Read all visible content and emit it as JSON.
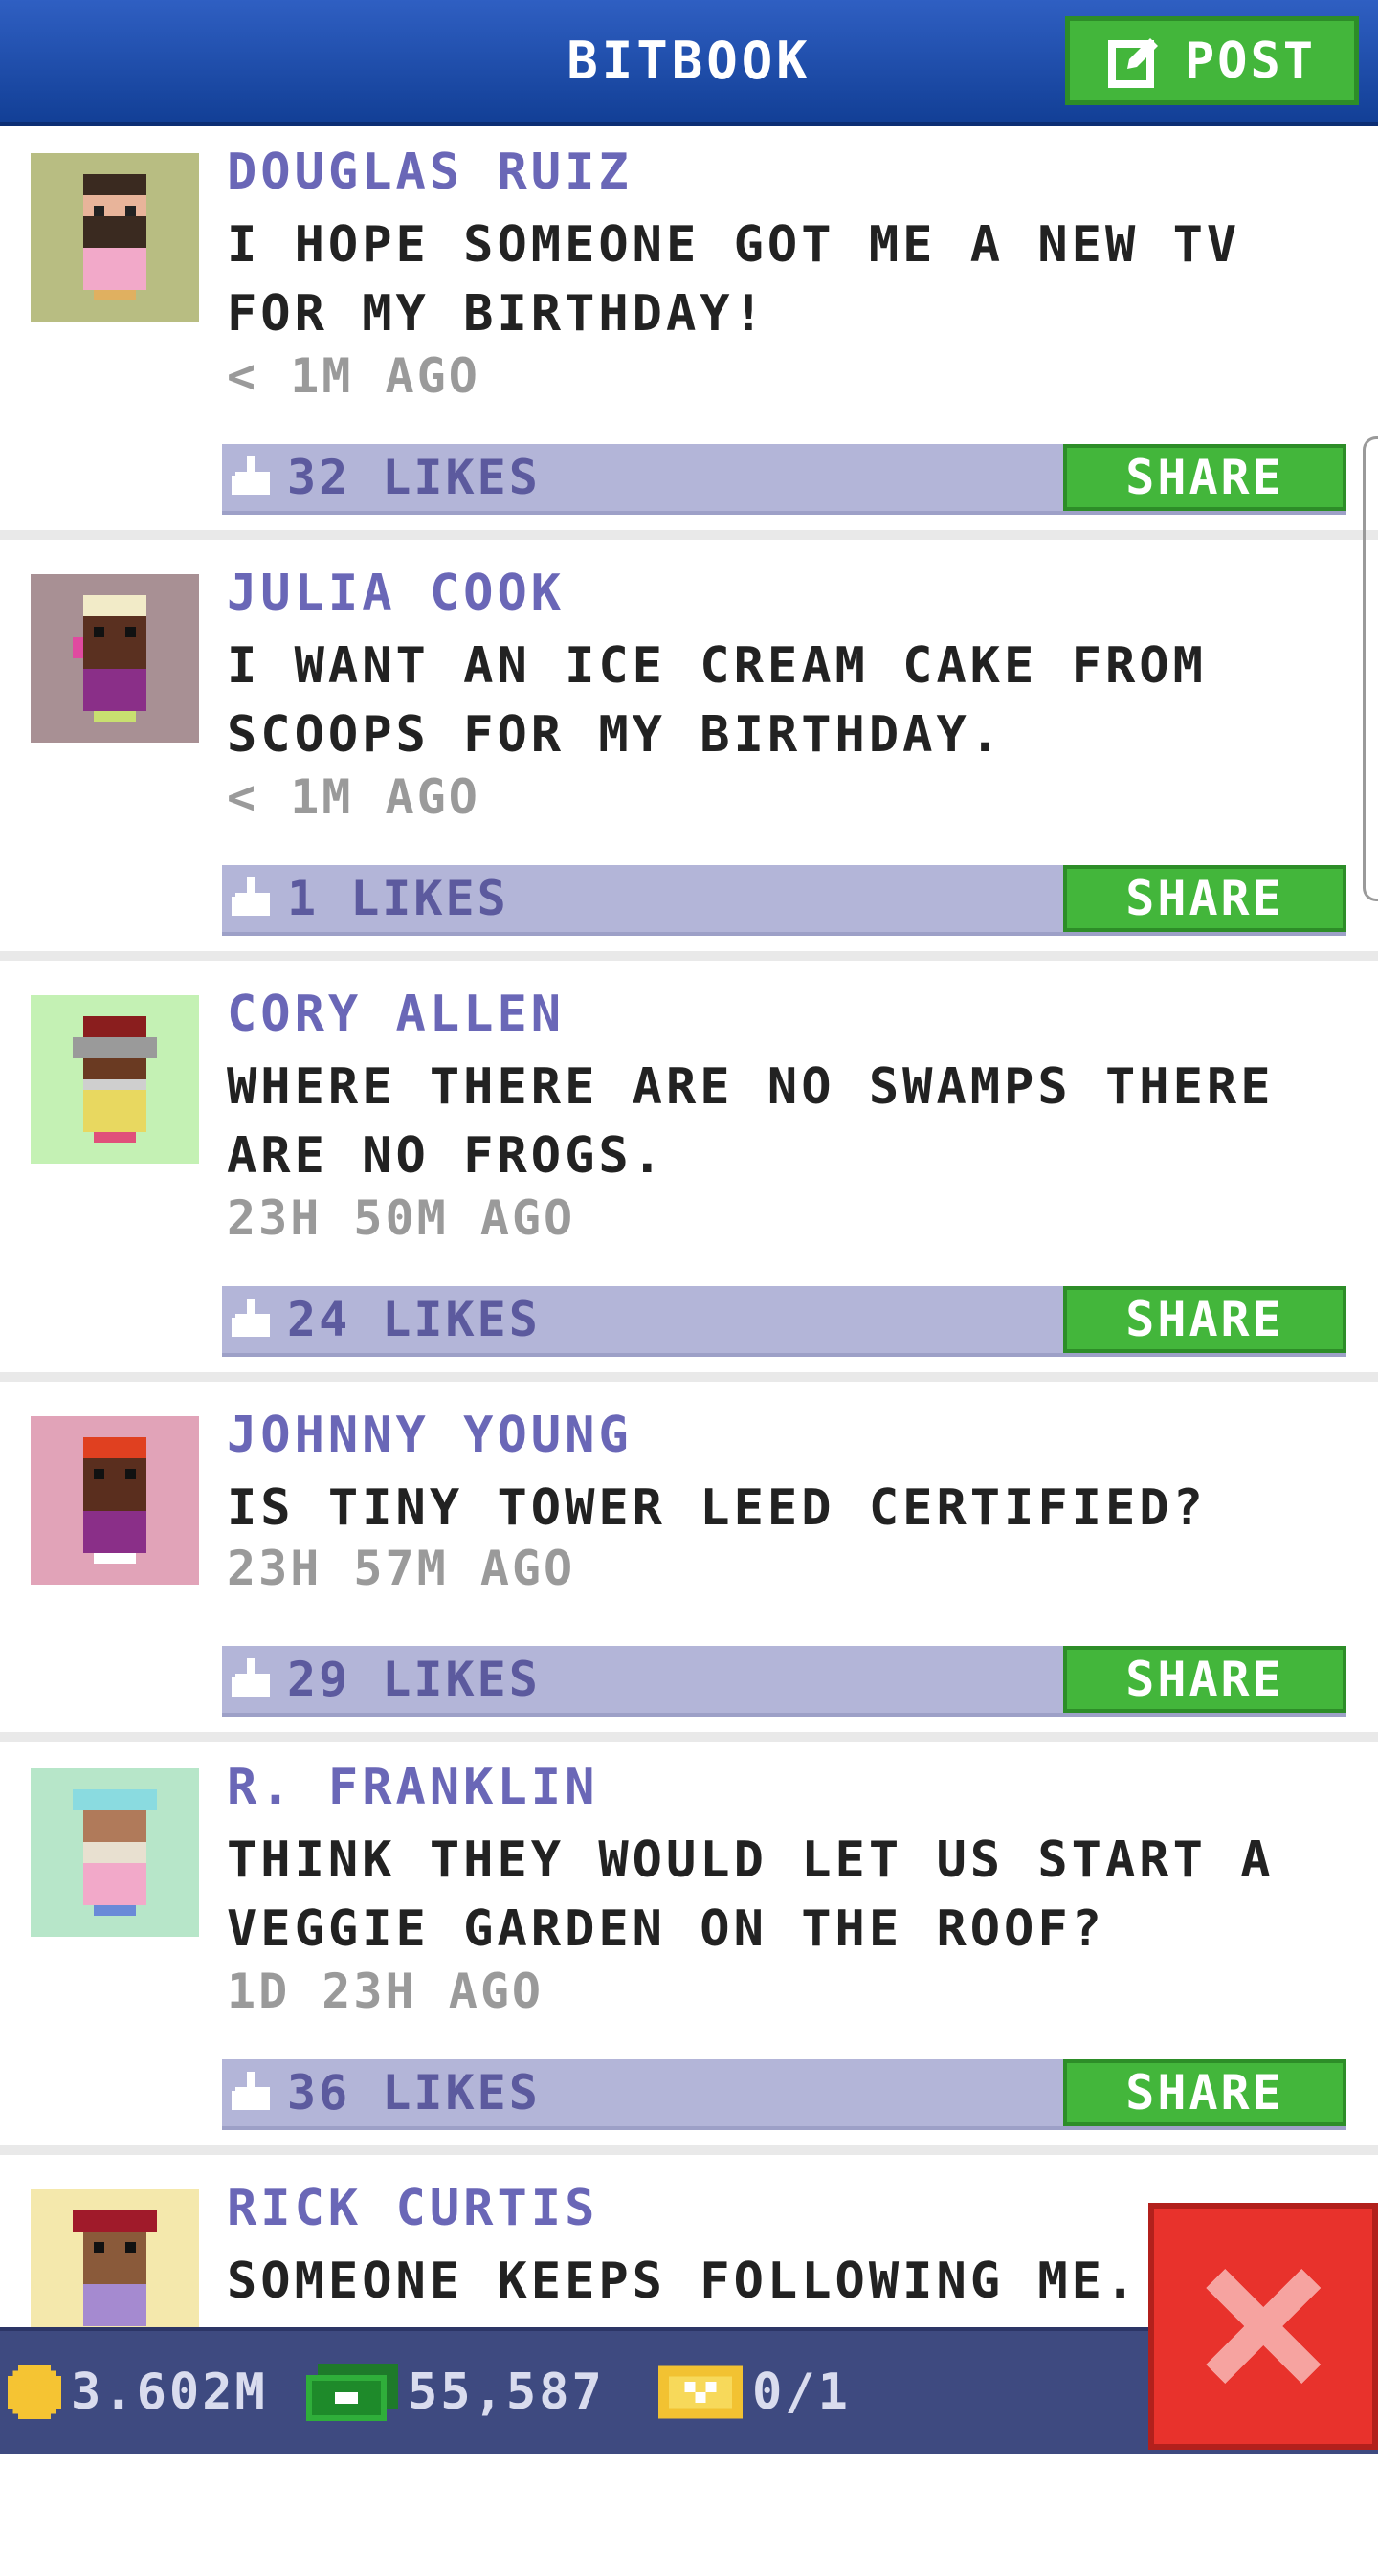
{
  "header": {
    "title": "BITBOOK",
    "post_label": "POST",
    "post_icon": "edit-icon"
  },
  "posts": [
    {
      "author": "DOUGLAS RUIZ",
      "body": "I HOPE SOMEONE GOT ME A NEW TV FOR MY BIRTHDAY!",
      "time": "< 1M AGO",
      "likes": "32 LIKES",
      "share": "SHARE",
      "avatar_bg": "#b8bd82"
    },
    {
      "author": "JULIA COOK",
      "body": "I WANT AN ICE CREAM CAKE FROM SCOOPS FOR MY BIRTHDAY.",
      "time": "< 1M AGO",
      "likes": "1 LIKES",
      "share": "SHARE",
      "avatar_bg": "#a89094"
    },
    {
      "author": "CORY ALLEN",
      "body": "WHERE THERE ARE NO SWAMPS THERE ARE NO FROGS.",
      "time": "23H 50M AGO",
      "likes": "24 LIKES",
      "share": "SHARE",
      "avatar_bg": "#c4f1b4"
    },
    {
      "author": "JOHNNY YOUNG",
      "body": "IS TINY TOWER LEED CERTIFIED?",
      "time": "23H 57M AGO",
      "likes": "29 LIKES",
      "share": "SHARE",
      "avatar_bg": "#e1a3b8"
    },
    {
      "author": "R. FRANKLIN",
      "body": "THINK THEY WOULD LET US START A VEGGIE GARDEN ON THE ROOF?",
      "time": "1D 23H AGO",
      "likes": "36 LIKES",
      "share": "SHARE",
      "avatar_bg": "#b7e6c9"
    },
    {
      "author": "RICK CURTIS",
      "body": "SOMEONE KEEPS FOLLOWING ME.",
      "time": "",
      "likes": "",
      "share": "",
      "avatar_bg": "#f4e8ac"
    }
  ],
  "status_bar": {
    "coins": "3.602M",
    "bux": "55,587",
    "tickets": "0/1"
  },
  "colors": {
    "brand_blue": "#1e4ca8",
    "share_green": "#43b63b",
    "likes_bar": "#b3b5d8",
    "close_red": "#e8322c"
  }
}
